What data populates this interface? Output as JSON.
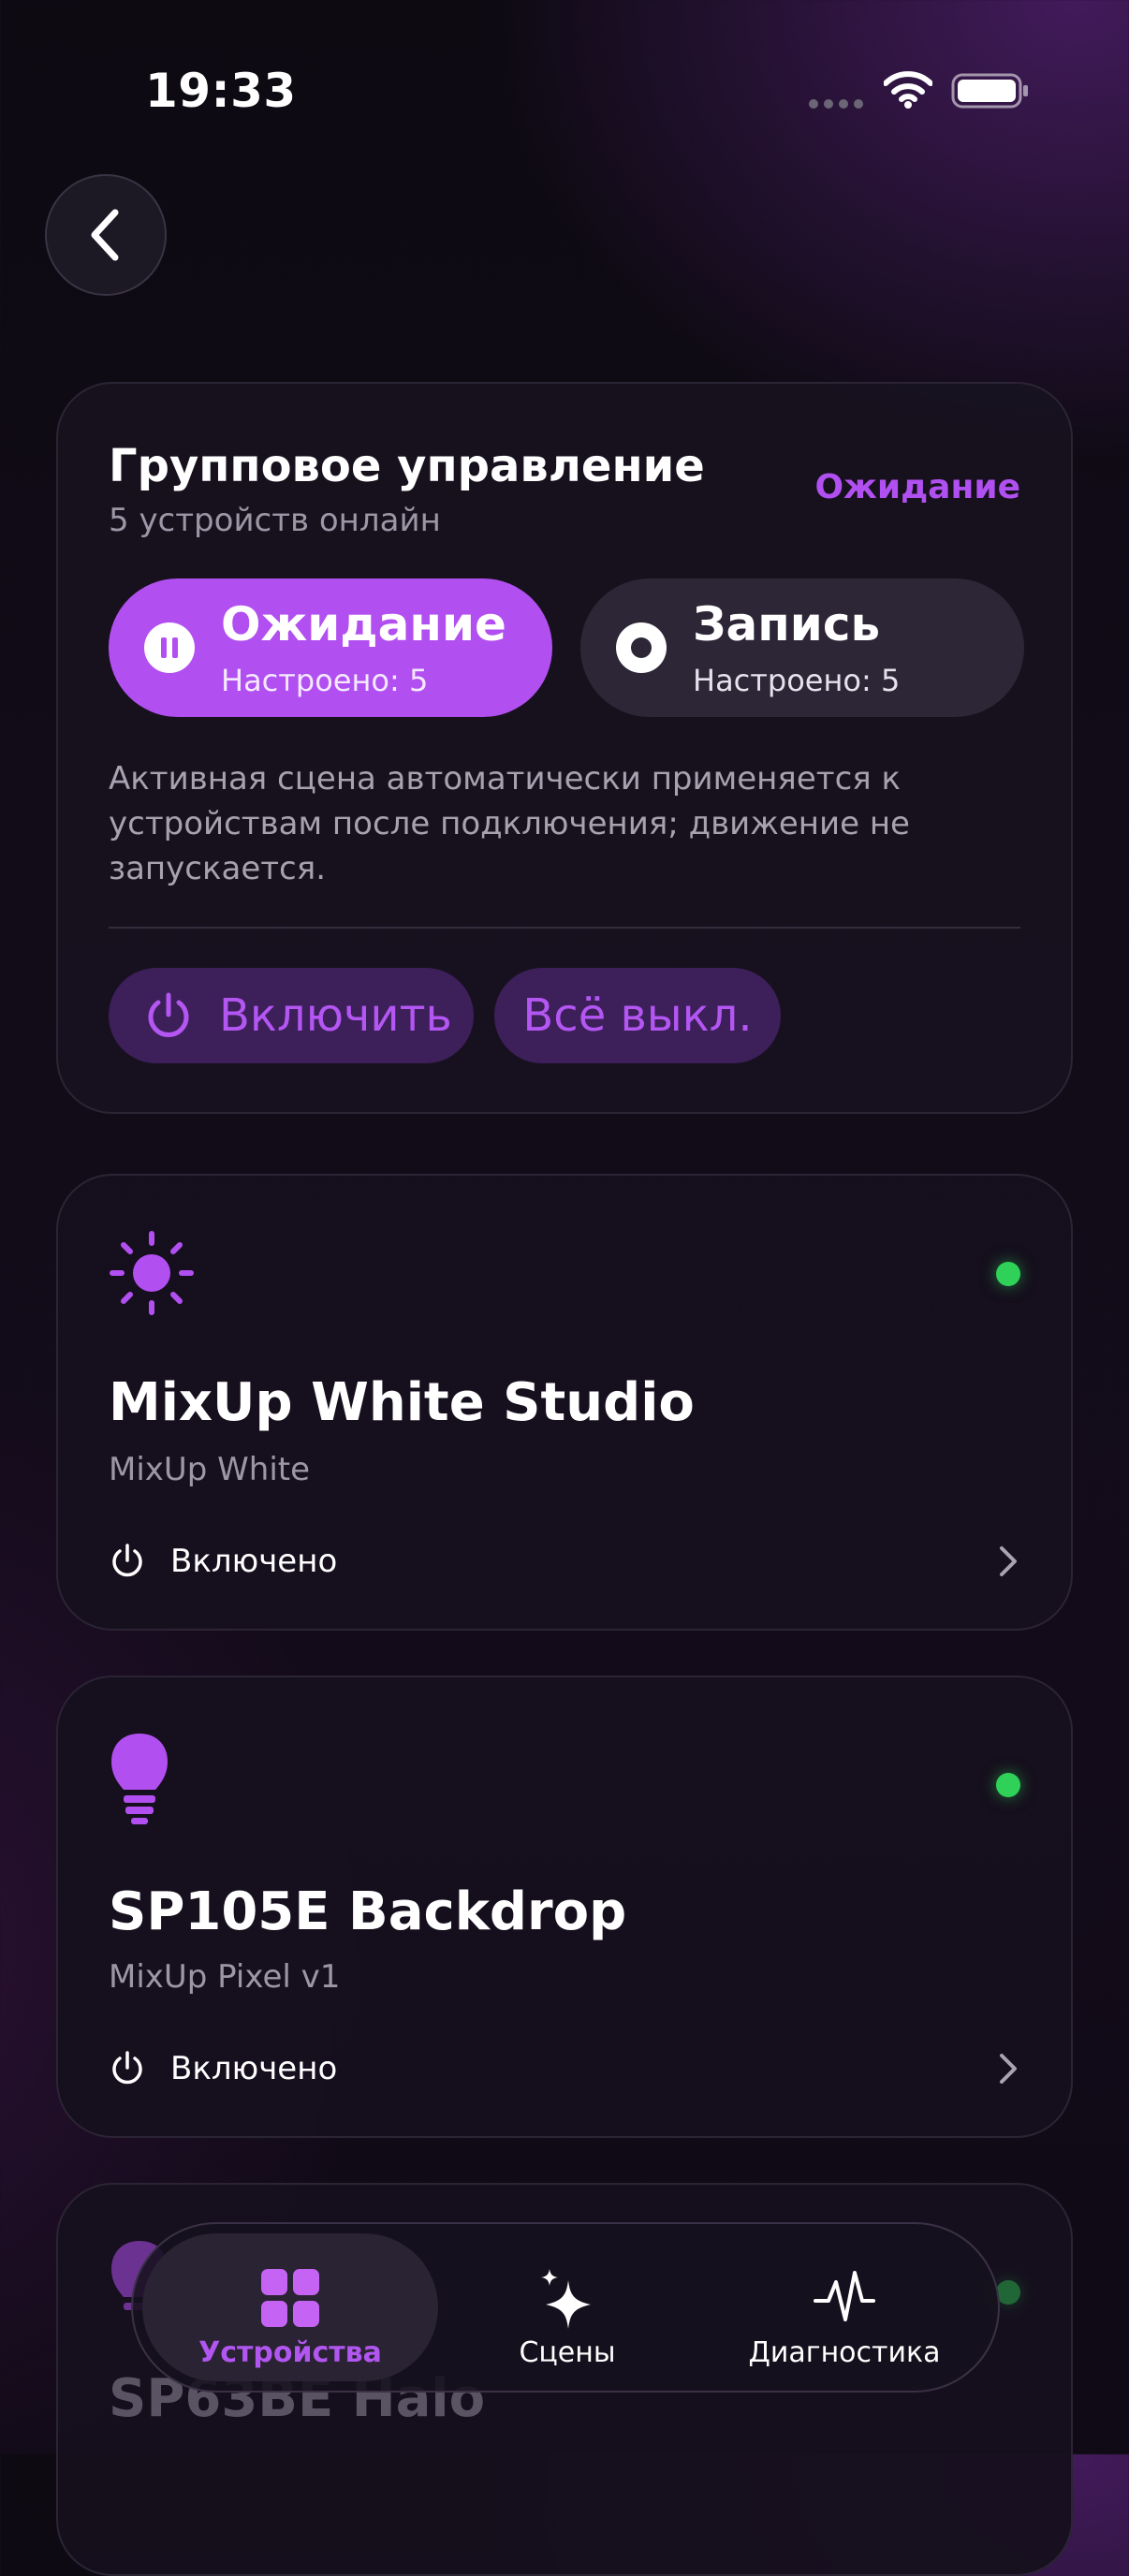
{
  "status_bar": {
    "time": "19:33",
    "icons": [
      "cellular-dots-icon",
      "wifi-icon",
      "battery-icon"
    ]
  },
  "nav": {
    "back_icon": "chevron-left-icon"
  },
  "group": {
    "title": "Групповое управление",
    "subtitle": "5 устройств онлайн",
    "status": "Ожидание",
    "modes": [
      {
        "label": "Ожидание",
        "sub": "Настроено: 5",
        "icon": "pause-icon",
        "active": true
      },
      {
        "label": "Запись",
        "sub": "Настроено: 5",
        "icon": "record-icon",
        "active": false
      }
    ],
    "description": "Активная сцена автоматически применяется к устройствам после подключения; движение не запускается.",
    "actions": {
      "on_label": "Включить",
      "off_label": "Всё выкл."
    }
  },
  "devices": [
    {
      "name": "MixUp White Studio",
      "model": "MixUp White",
      "state": "Включено",
      "icon": "sun-icon",
      "online": true
    },
    {
      "name": "SP105E Backdrop",
      "model": "MixUp Pixel v1",
      "state": "Включено",
      "icon": "bulb-icon",
      "online": true
    },
    {
      "name": "SP63BE Halo",
      "icon": "bulb-icon",
      "online": true
    }
  ],
  "tabs": [
    {
      "label": "Устройства",
      "icon": "grid-icon",
      "active": true
    },
    {
      "label": "Сцены",
      "icon": "sparkles-icon",
      "active": false
    },
    {
      "label": "Диагностика",
      "icon": "pulse-icon",
      "active": false
    }
  ],
  "colors": {
    "accent": "#b24ff0",
    "online": "#2fd158",
    "background": "#120c19",
    "card": "#181220"
  }
}
